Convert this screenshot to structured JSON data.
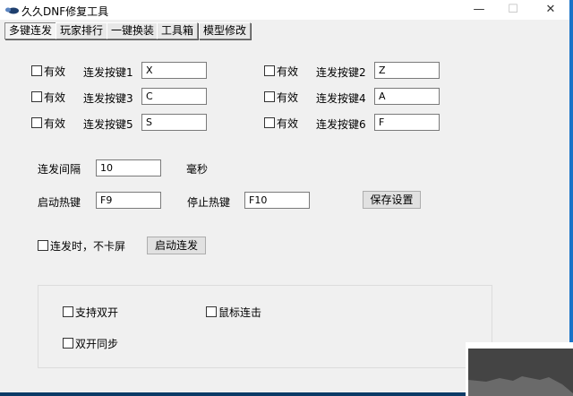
{
  "window": {
    "title": "久久DNF修复工具",
    "minimize": "—",
    "maximize": "☐",
    "close": "✕"
  },
  "tabs": [
    {
      "label": "多键连发"
    },
    {
      "label": "玩家排行"
    },
    {
      "label": "一键换装"
    },
    {
      "label": "工具箱"
    },
    {
      "label": "模型修改"
    }
  ],
  "keys": [
    {
      "enable": "有效",
      "label": "连发按键1",
      "value": "X"
    },
    {
      "enable": "有效",
      "label": "连发按键2",
      "value": "Z"
    },
    {
      "enable": "有效",
      "label": "连发按键3",
      "value": "C"
    },
    {
      "enable": "有效",
      "label": "连发按键4",
      "value": "A"
    },
    {
      "enable": "有效",
      "label": "连发按键5",
      "value": "S"
    },
    {
      "enable": "有效",
      "label": "连发按键6",
      "value": "F"
    }
  ],
  "interval": {
    "label": "连发间隔",
    "value": "10",
    "unit": "毫秒"
  },
  "hotkeys": {
    "start_label": "启动热键",
    "start_value": "F9",
    "stop_label": "停止热键",
    "stop_value": "F10",
    "save": "保存设置"
  },
  "nolag": "连发时，不卡屏",
  "start_button": "启动连发",
  "group": {
    "dual": "支持双开",
    "mouse": "鼠标连击",
    "sync": "双开同步"
  }
}
